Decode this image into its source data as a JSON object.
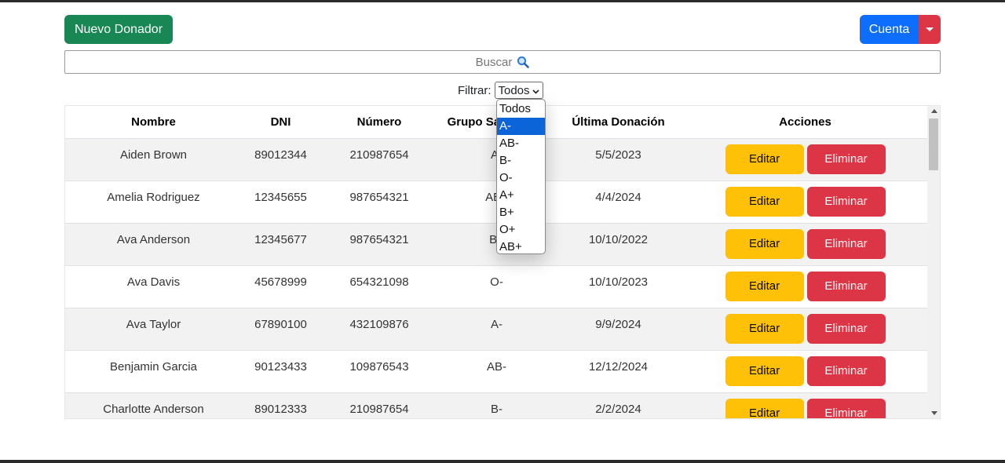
{
  "header": {
    "new_donor_label": "Nuevo Donador",
    "account_label": "Cuenta"
  },
  "search": {
    "placeholder": "Buscar"
  },
  "filter": {
    "label": "Filtrar:",
    "selected": "Todos",
    "highlighted": "A-",
    "options": [
      "Todos",
      "A-",
      "AB-",
      "B-",
      "O-",
      "A+",
      "B+",
      "O+",
      "AB+"
    ]
  },
  "table": {
    "columns": [
      "Nombre",
      "DNI",
      "Número",
      "Grupo Sanguíneo",
      "Última Donación",
      "Acciones"
    ],
    "rows": [
      {
        "name": "Aiden Brown",
        "dni": "89012344",
        "number": "210987654",
        "blood": "A-",
        "last": "5/5/2023"
      },
      {
        "name": "Amelia Rodriguez",
        "dni": "12345655",
        "number": "987654321",
        "blood": "AB+",
        "last": "4/4/2024"
      },
      {
        "name": "Ava Anderson",
        "dni": "12345677",
        "number": "987654321",
        "blood": "B+",
        "last": "10/10/2022"
      },
      {
        "name": "Ava Davis",
        "dni": "45678999",
        "number": "654321098",
        "blood": "O-",
        "last": "10/10/2023"
      },
      {
        "name": "Ava Taylor",
        "dni": "67890100",
        "number": "432109876",
        "blood": "A-",
        "last": "9/9/2024"
      },
      {
        "name": "Benjamin Garcia",
        "dni": "90123433",
        "number": "109876543",
        "blood": "AB-",
        "last": "12/12/2024"
      },
      {
        "name": "Charlotte Anderson",
        "dni": "89012333",
        "number": "210987654",
        "blood": "B-",
        "last": "2/2/2024"
      }
    ],
    "edit_label": "Editar",
    "delete_label": "Eliminar"
  },
  "colors": {
    "success": "#198754",
    "primary": "#0d6efd",
    "danger": "#dc3545",
    "warning": "#ffc107",
    "highlight": "#0b64d8"
  },
  "icons": {
    "search": "magnifier-icon",
    "account_toggle": "caret-down-icon",
    "select": "chevron-down-icon"
  }
}
